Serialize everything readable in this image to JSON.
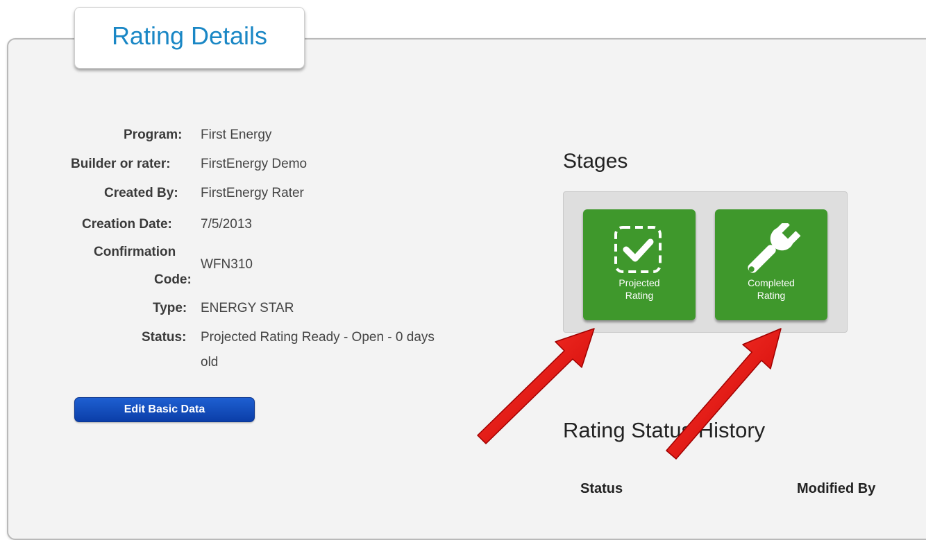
{
  "header": {
    "title": "Rating Details"
  },
  "details": [
    {
      "label": "Program:",
      "value": "First Energy"
    },
    {
      "label": "Builder or rater:",
      "value": "FirstEnergy Demo"
    },
    {
      "label": "Created By:",
      "value": "FirstEnergy Rater"
    },
    {
      "label": "Creation Date:",
      "value": "7/5/2013"
    },
    {
      "label_line1": "Confirmation",
      "label_line2": "Code:",
      "value": "WFN310"
    },
    {
      "label": "Type:",
      "value": "ENERGY STAR"
    },
    {
      "label": "Status:",
      "value_line1": "Projected Rating Ready - Open - 0 days",
      "value_line2": "old"
    }
  ],
  "actions": {
    "edit_label": "Edit Basic Data"
  },
  "stages": {
    "title": "Stages",
    "items": [
      {
        "icon": "checkbox-check-icon",
        "line1": "Projected",
        "line2": "Rating"
      },
      {
        "icon": "wrench-icon",
        "line1": "Completed",
        "line2": "Rating"
      }
    ]
  },
  "history": {
    "title": "Rating Status History",
    "columns": [
      "Status",
      "Modified By"
    ]
  },
  "colors": {
    "accent": "#1a87c5",
    "stage_green": "#3f982c",
    "button_blue": "#0b3ea8",
    "arrow_red": "#e8110f"
  }
}
